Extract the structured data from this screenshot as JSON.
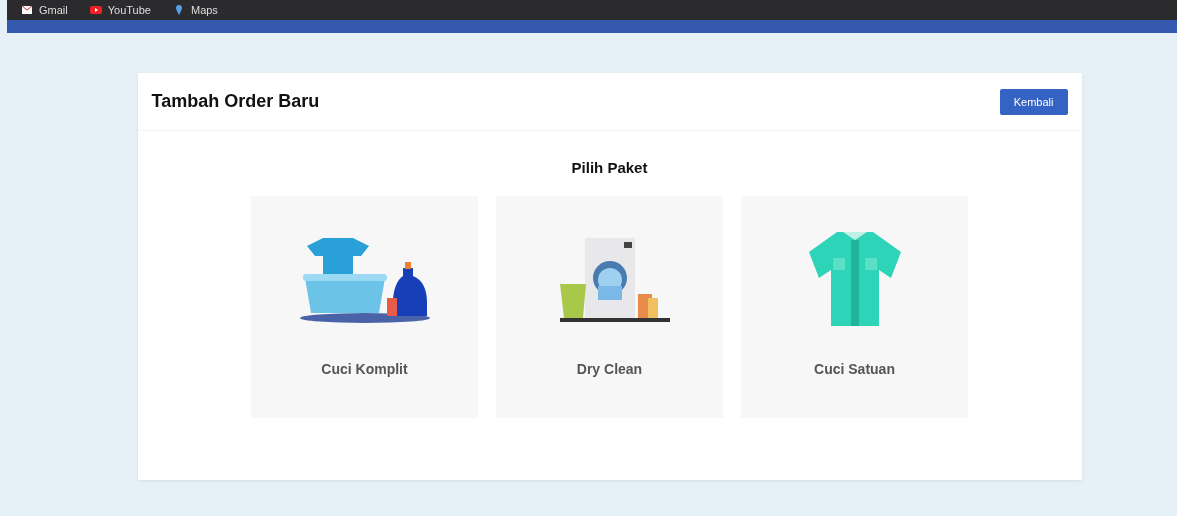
{
  "bookmarks": [
    {
      "label": "Gmail",
      "kind": "gmail"
    },
    {
      "label": "YouTube",
      "kind": "youtube"
    },
    {
      "label": "Maps",
      "kind": "maps"
    }
  ],
  "page": {
    "title": "Tambah Order Baru",
    "back_button": "Kembali"
  },
  "section_title": "Pilih Paket",
  "packages": [
    {
      "label": "Cuci Komplit",
      "kind": "wash"
    },
    {
      "label": "Dry Clean",
      "kind": "machine"
    },
    {
      "label": "Cuci Satuan",
      "kind": "shirt"
    }
  ]
}
